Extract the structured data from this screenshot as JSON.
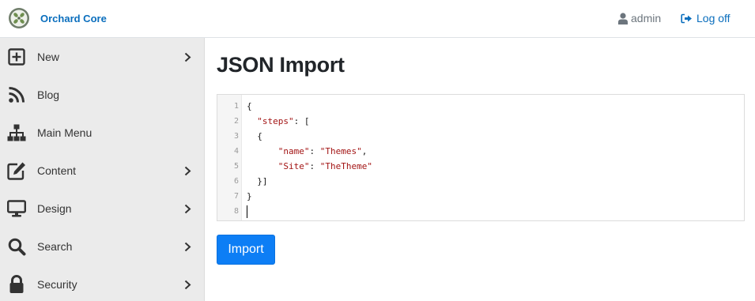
{
  "header": {
    "brand": "Orchard Core",
    "username": "admin",
    "logoff_label": "Log off"
  },
  "sidebar": {
    "items": [
      {
        "label": "New",
        "icon": "plus-square-icon",
        "has_submenu": true
      },
      {
        "label": "Blog",
        "icon": "rss-icon",
        "has_submenu": false
      },
      {
        "label": "Main Menu",
        "icon": "sitemap-icon",
        "has_submenu": false
      },
      {
        "label": "Content",
        "icon": "edit-icon",
        "has_submenu": true
      },
      {
        "label": "Design",
        "icon": "desktop-icon",
        "has_submenu": true
      },
      {
        "label": "Search",
        "icon": "search-icon",
        "has_submenu": true
      },
      {
        "label": "Security",
        "icon": "lock-icon",
        "has_submenu": true
      }
    ]
  },
  "main": {
    "title": "JSON Import",
    "editor": {
      "line_numbers": [
        "1",
        "2",
        "3",
        "4",
        "5",
        "6",
        "7",
        "8"
      ],
      "lines": [
        [
          {
            "t": "{",
            "c": "plain"
          }
        ],
        [
          {
            "t": "  ",
            "c": "plain"
          },
          {
            "t": "\"steps\"",
            "c": "key"
          },
          {
            "t": ": [",
            "c": "plain"
          }
        ],
        [
          {
            "t": "  {",
            "c": "plain"
          }
        ],
        [
          {
            "t": "      ",
            "c": "plain"
          },
          {
            "t": "\"name\"",
            "c": "key"
          },
          {
            "t": ": ",
            "c": "plain"
          },
          {
            "t": "\"Themes\"",
            "c": "str"
          },
          {
            "t": ",",
            "c": "plain"
          }
        ],
        [
          {
            "t": "      ",
            "c": "plain"
          },
          {
            "t": "\"Site\"",
            "c": "key"
          },
          {
            "t": ": ",
            "c": "plain"
          },
          {
            "t": "\"TheTheme\"",
            "c": "str"
          }
        ],
        [
          {
            "t": "  }]",
            "c": "plain"
          }
        ],
        [
          {
            "t": "}",
            "c": "plain"
          }
        ],
        []
      ]
    },
    "import_label": "Import"
  },
  "colors": {
    "brand": "#0a6ebd",
    "button": "#0d7ef5",
    "sidebar_bg": "#ebebeb",
    "json_token": "#a31515"
  }
}
